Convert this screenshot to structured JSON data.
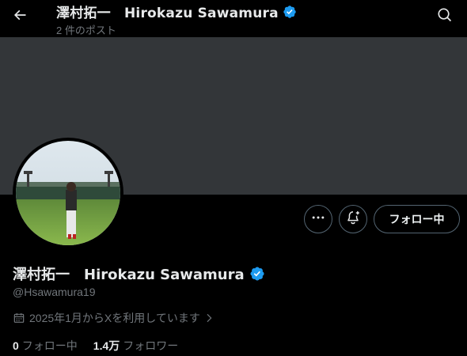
{
  "header": {
    "name": "澤村拓一　Hirokazu Sawamura",
    "post_count": "2 件のポスト"
  },
  "profile": {
    "name": "澤村拓一　Hirokazu Sawamura",
    "handle": "@Hsawamura19",
    "joined": "2025年1月からXを利用しています",
    "following_count": "0",
    "following_label": "フォロー中",
    "followers_count": "1.4万",
    "followers_label": "フォロワー"
  },
  "actions": {
    "follow_label": "フォロー中"
  },
  "colors": {
    "background": "#000000",
    "banner": "#333639",
    "verified": "#1d9bf0",
    "secondary_text": "#71767b",
    "border": "#536471"
  },
  "icons": {
    "back": "arrow-left-icon",
    "search": "search-icon",
    "more": "more-horizontal-icon",
    "notify": "bell-plus-icon",
    "verified": "verified-badge-icon",
    "calendar": "calendar-icon",
    "chevron": "chevron-right-icon"
  }
}
